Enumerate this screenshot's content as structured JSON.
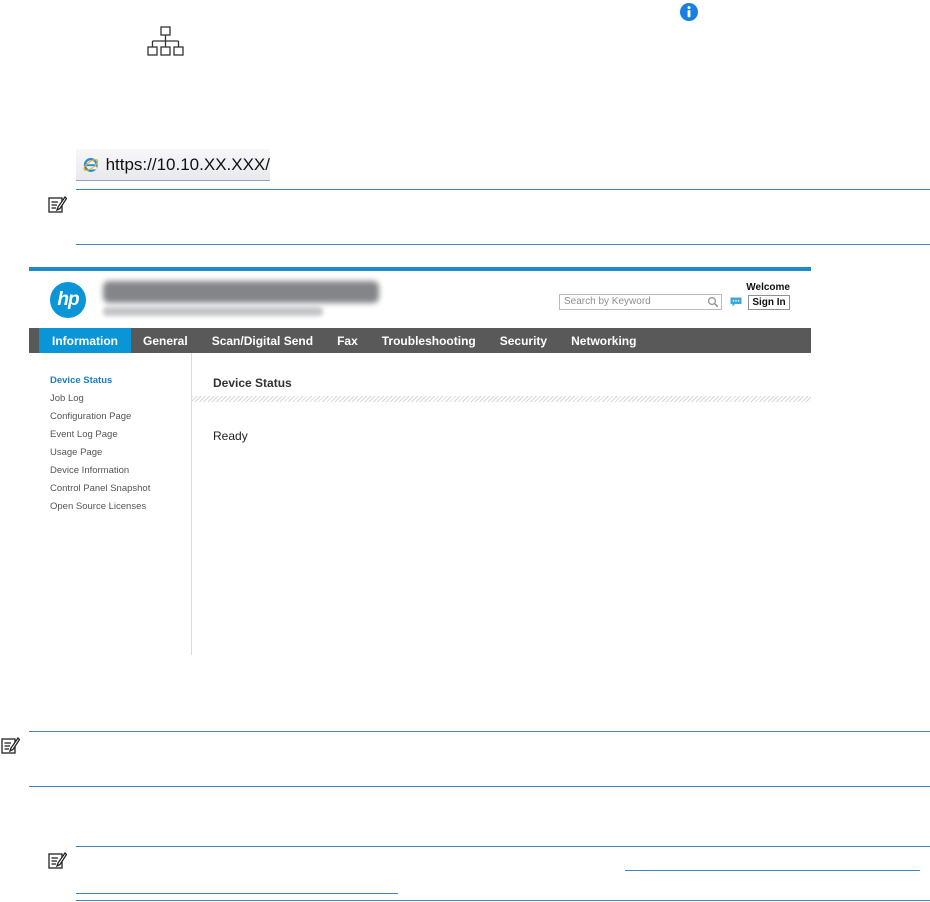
{
  "url_bar": {
    "url": "https://10.10.XX.XXX/"
  },
  "ews": {
    "logo": "hp",
    "header": {
      "welcome": "Welcome",
      "search_placeholder": "Search by Keyword",
      "sign_in": "Sign In"
    },
    "tabs": [
      "Information",
      "General",
      "Scan/Digital Send",
      "Fax",
      "Troubleshooting",
      "Security",
      "Networking"
    ],
    "active_tab": "Information",
    "sidebar": [
      "Device Status",
      "Job Log",
      "Configuration Page",
      "Event Log Page",
      "Usage Page",
      "Device Information",
      "Control Panel Snapshot",
      "Open Source Licenses"
    ],
    "content": {
      "title": "Device Status",
      "status": "Ready"
    }
  },
  "colors": {
    "accent": "#1c8bc8",
    "rule": "#3a86c8",
    "info": "#1a7fe0",
    "nav_bg": "#595959",
    "tab_active": "#0a96d6"
  },
  "icons": [
    "info-icon",
    "network-icon",
    "ie-browser-icon",
    "note-icon",
    "search-icon",
    "chat-icon"
  ]
}
